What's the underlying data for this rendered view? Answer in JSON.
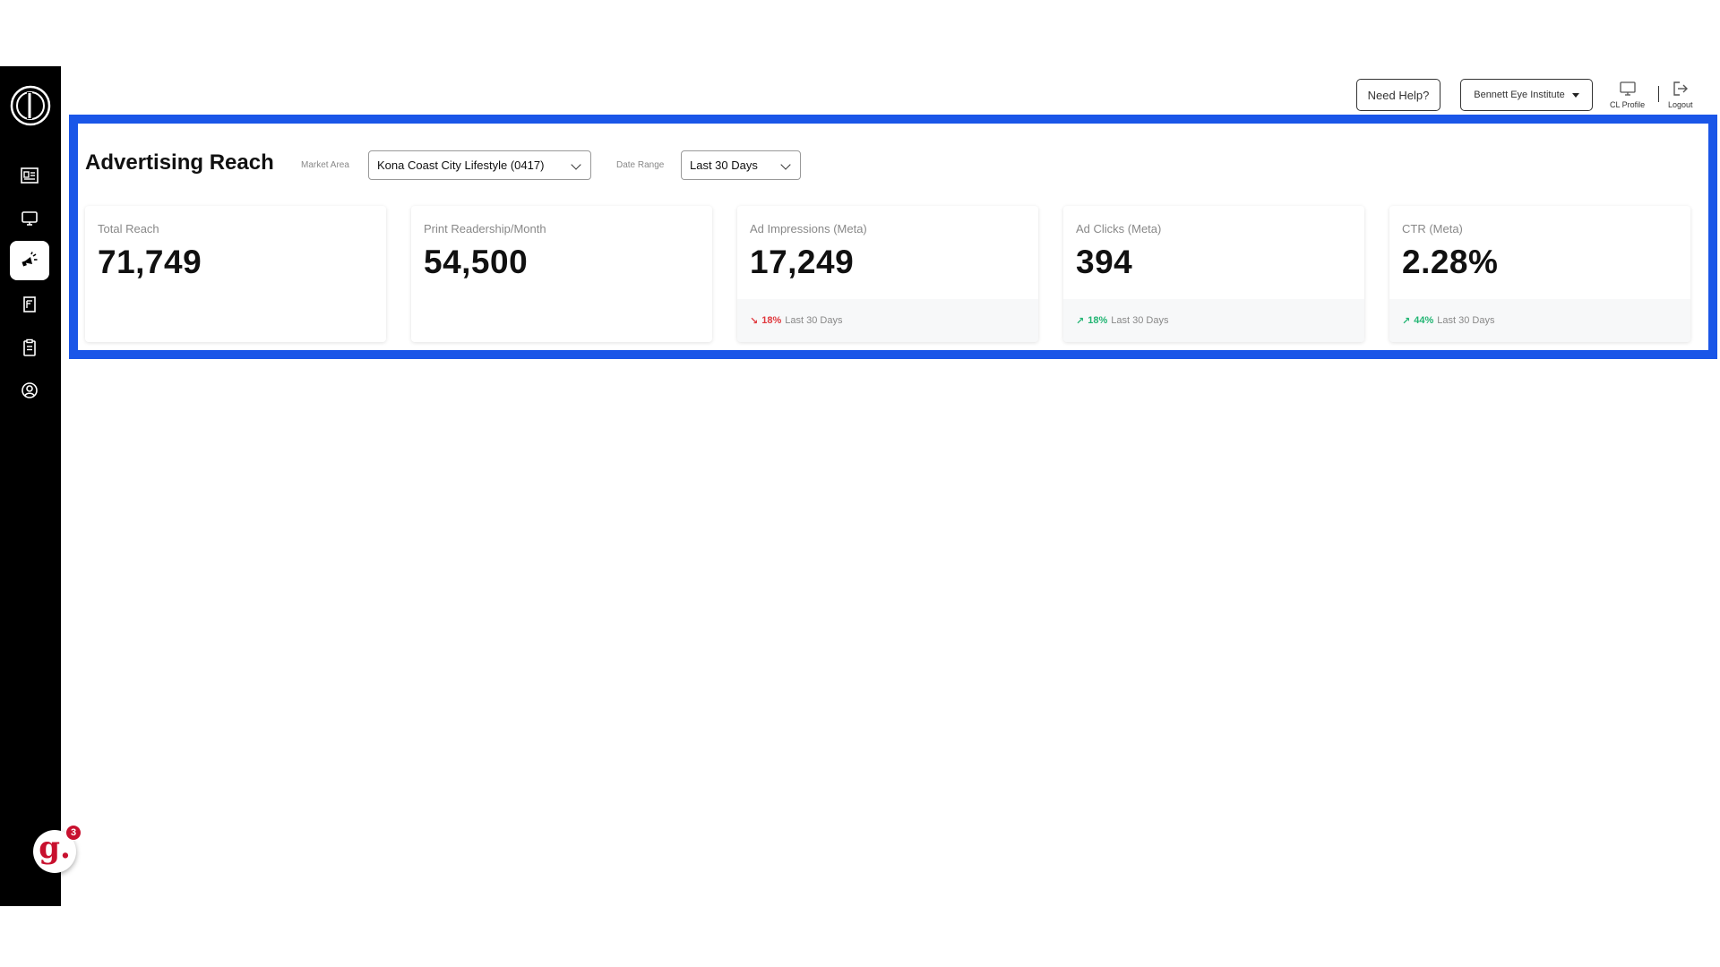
{
  "colors": {
    "sidebar_bg": "#000000",
    "highlight_border": "#1a56e8",
    "trend_down": "#e0393e",
    "trend_up": "#22b573",
    "brand_red": "#c8102e"
  },
  "sidebar": {
    "logo": "circle-l-logo",
    "items": [
      {
        "icon": "news-icon",
        "active": false
      },
      {
        "icon": "monitor-icon",
        "active": false
      },
      {
        "icon": "megaphone-icon",
        "active": true
      },
      {
        "icon": "magazine-icon",
        "active": false
      },
      {
        "icon": "clipboard-icon",
        "active": false
      },
      {
        "icon": "user-circle-icon",
        "active": false
      }
    ],
    "widget": {
      "letter": "g.",
      "count": "3"
    }
  },
  "topbar": {
    "help_label": "Need Help?",
    "account_label": "Bennett Eye Institute",
    "profile_label": "CL Profile",
    "logout_label": "Logout"
  },
  "panel": {
    "title": "Advertising Reach",
    "market_area": {
      "label": "Market Area",
      "value": "Kona Coast City Lifestyle (0417)"
    },
    "date_range": {
      "label": "Date Range",
      "value": "Last 30 Days"
    },
    "cards": [
      {
        "label": "Total Reach",
        "value": "71,749"
      },
      {
        "label": "Print Readership/Month",
        "value": "54,500"
      },
      {
        "label": "Ad Impressions (Meta)",
        "value": "17,249",
        "trend_arrow": "↘",
        "trend": "18%",
        "trend_dir": "down",
        "period": "Last 30 Days"
      },
      {
        "label": "Ad Clicks (Meta)",
        "value": "394",
        "trend_arrow": "↗",
        "trend": "18%",
        "trend_dir": "up",
        "period": "Last 30 Days"
      },
      {
        "label": "CTR (Meta)",
        "value": "2.28%",
        "trend_arrow": "↗",
        "trend": "44%",
        "trend_dir": "up",
        "period": "Last 30 Days"
      }
    ]
  }
}
